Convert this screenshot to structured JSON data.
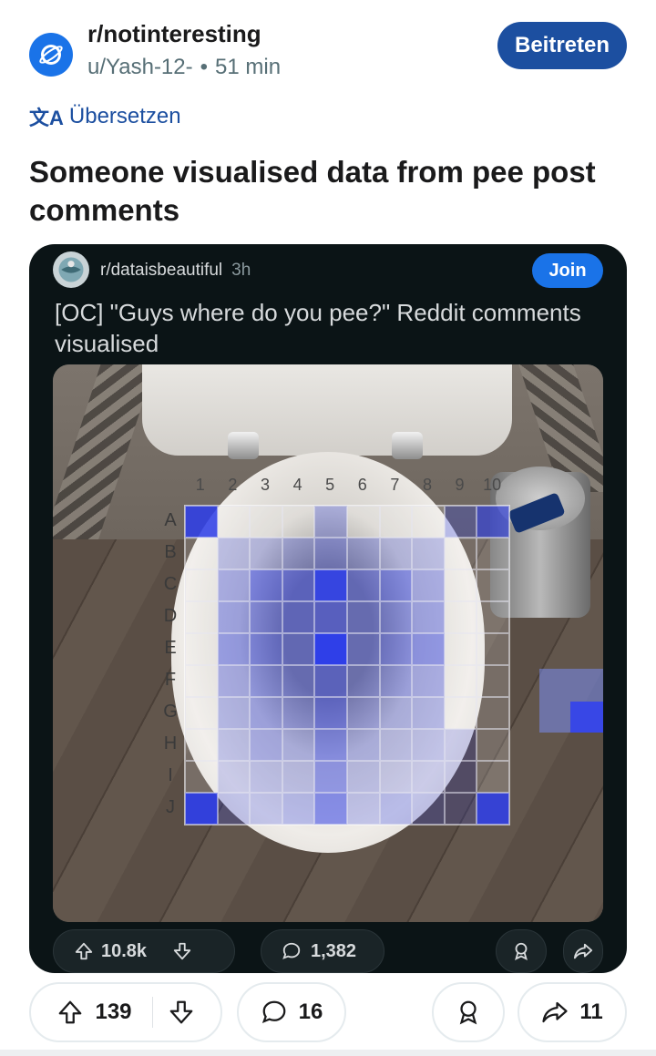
{
  "post": {
    "subreddit": "r/notinteresting",
    "author": "u/Yash-12-",
    "separator": "•",
    "age": "51 min",
    "join_label": "Beitreten",
    "translate_label": "Übersetzen",
    "title": "Someone visualised data from pee post comments"
  },
  "embed": {
    "subreddit": "r/dataisbeautiful",
    "age": "3h",
    "join_label": "Join",
    "title": "[OC] \"Guys where do you pee?\" Reddit comments visualised",
    "col_labels": [
      "1",
      "2",
      "3",
      "4",
      "5",
      "6",
      "7",
      "8",
      "9",
      "10"
    ],
    "row_labels": [
      "A",
      "B",
      "C",
      "D",
      "E",
      "F",
      "G",
      "H",
      "I",
      "J"
    ],
    "heatmap": [
      [
        0.85,
        0,
        0,
        0,
        0.15,
        0,
        0,
        0,
        0.15,
        0.55
      ],
      [
        0,
        0.1,
        0.1,
        0.15,
        0.25,
        0.15,
        0.1,
        0.1,
        0,
        0
      ],
      [
        0,
        0.2,
        0.45,
        0.45,
        0.9,
        0.35,
        0.4,
        0.2,
        0,
        0
      ],
      [
        0,
        0.25,
        0.35,
        0.4,
        0.5,
        0.3,
        0.3,
        0.25,
        0,
        0
      ],
      [
        0,
        0.3,
        0.4,
        0.35,
        1.0,
        0.3,
        0.35,
        0.35,
        0,
        0
      ],
      [
        0,
        0.2,
        0.3,
        0.3,
        0.45,
        0.25,
        0.25,
        0.2,
        0,
        0
      ],
      [
        0,
        0.15,
        0.25,
        0.25,
        0.45,
        0.2,
        0.15,
        0.15,
        0,
        0
      ],
      [
        0,
        0.1,
        0.2,
        0.15,
        0.4,
        0.15,
        0.1,
        0.1,
        0.05,
        0
      ],
      [
        0,
        0.05,
        0.1,
        0.1,
        0.35,
        0.1,
        0.05,
        0.05,
        0.05,
        0
      ],
      [
        0.9,
        0.1,
        0.1,
        0.15,
        0.45,
        0.1,
        0.15,
        0.1,
        0.05,
        0.85
      ]
    ],
    "upvotes": "10.8k",
    "comments": "1,382"
  },
  "actions": {
    "upvotes": "139",
    "comments": "16",
    "shares": "11"
  },
  "colors": {
    "accent": "#1c4fa0",
    "embed_bg": "#0b1416",
    "heat": "#2f3fe8"
  }
}
